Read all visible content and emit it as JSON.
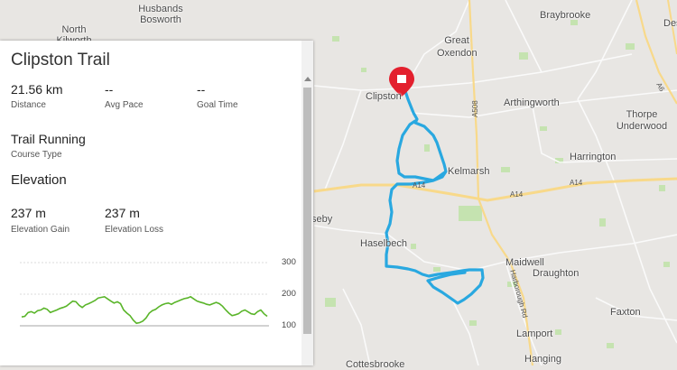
{
  "panel": {
    "title": "Clipston Trail",
    "stats": [
      {
        "value": "21.56 km",
        "label": "Distance"
      },
      {
        "value": "--",
        "label": "Avg Pace"
      },
      {
        "value": "--",
        "label": "Goal Time"
      }
    ],
    "course_type": {
      "value": "Trail Running",
      "label": "Course Type"
    },
    "elevation_heading": "Elevation",
    "elevation_stats": [
      {
        "value": "237 m",
        "label": "Elevation Gain"
      },
      {
        "value": "237 m",
        "label": "Elevation Loss"
      }
    ]
  },
  "chart_data": {
    "type": "line",
    "title": "",
    "xlabel": "",
    "ylabel": "",
    "ylim": [
      100,
      300
    ],
    "yticks": [
      300,
      200,
      100
    ],
    "color": "#5ab52a",
    "series": [
      {
        "values": [
          128,
          130,
          142,
          145,
          140,
          148,
          150,
          156,
          152,
          142,
          146,
          150,
          155,
          158,
          162,
          170,
          178,
          176,
          165,
          158,
          166,
          170,
          175,
          180,
          188,
          190,
          192,
          185,
          178,
          172,
          176,
          170,
          150,
          140,
          132,
          118,
          108,
          110,
          115,
          125,
          140,
          148,
          152,
          160,
          166,
          170,
          172,
          168,
          174,
          178,
          182,
          186,
          188,
          192,
          185,
          178,
          175,
          172,
          168,
          166,
          170,
          174,
          170,
          162,
          150,
          140,
          132,
          135,
          138,
          146,
          150,
          144,
          138,
          136,
          145,
          150,
          138,
          130
        ]
      }
    ]
  },
  "map": {
    "route_color": "#29a8e0",
    "marker_color": "#e3202e",
    "places": [
      "North Kilworth",
      "Husbands Bosworth",
      "Braybrooke",
      "Great Oxendon",
      "Clipston",
      "Arthingworth",
      "Thorpe Underwood",
      "Harrington",
      "Kelmarsh",
      "Haselbech",
      "Maidwell",
      "Draughton",
      "Faxton",
      "Lamport",
      "Hanging",
      "Cottesbrooke",
      "Naseby",
      "Des"
    ],
    "roads": [
      "A14",
      "A14",
      "A508",
      "A6",
      "Harborough Rd"
    ]
  }
}
